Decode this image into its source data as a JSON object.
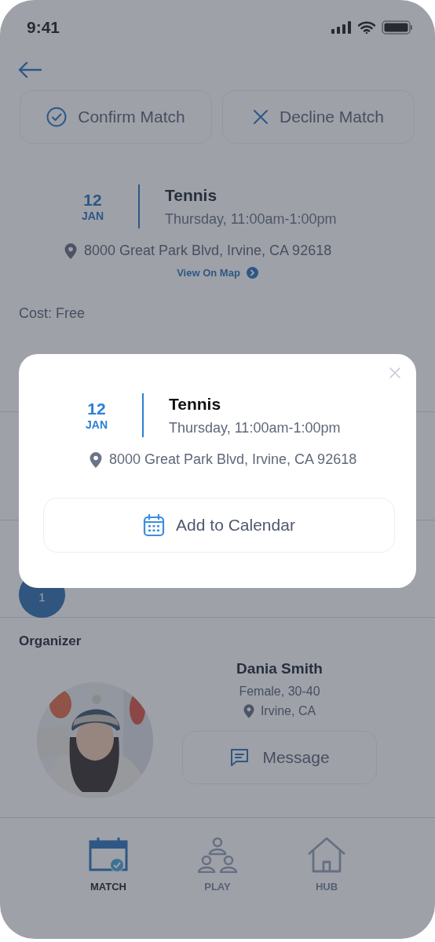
{
  "status_bar": {
    "time": "9:41"
  },
  "actions": [
    {
      "kind": "confirm",
      "label": "Confirm Match"
    },
    {
      "kind": "decline",
      "label": "Decline Match"
    }
  ],
  "event": {
    "day": "12",
    "month": "JAN",
    "sport": "Tennis",
    "time": "Thursday, 11:00am-1:00pm",
    "address": "8000 Great Park Blvd, Irvine, CA 92618",
    "map_link": "View On Map"
  },
  "cost": "Cost: Free",
  "players": [
    {
      "label": "1"
    }
  ],
  "organizer": {
    "heading": "Organizer",
    "name": "Dania Smith",
    "details": "Female, 30-40",
    "location": "Irvine, CA",
    "message_button": "Message"
  },
  "tab_bar": [
    {
      "kind": "match",
      "label": "MATCH",
      "selected": true
    },
    {
      "kind": "play",
      "label": "PLAY",
      "selected": false
    },
    {
      "kind": "hub",
      "label": "HUB",
      "selected": false
    }
  ],
  "modal": {
    "open": true,
    "day": "12",
    "month": "JAN",
    "sport": "Tennis",
    "time": "Thursday, 11:00am-1:00pm",
    "address": "8000 Great Park Blvd, Irvine, CA 92618",
    "button": "Add to Calendar"
  }
}
